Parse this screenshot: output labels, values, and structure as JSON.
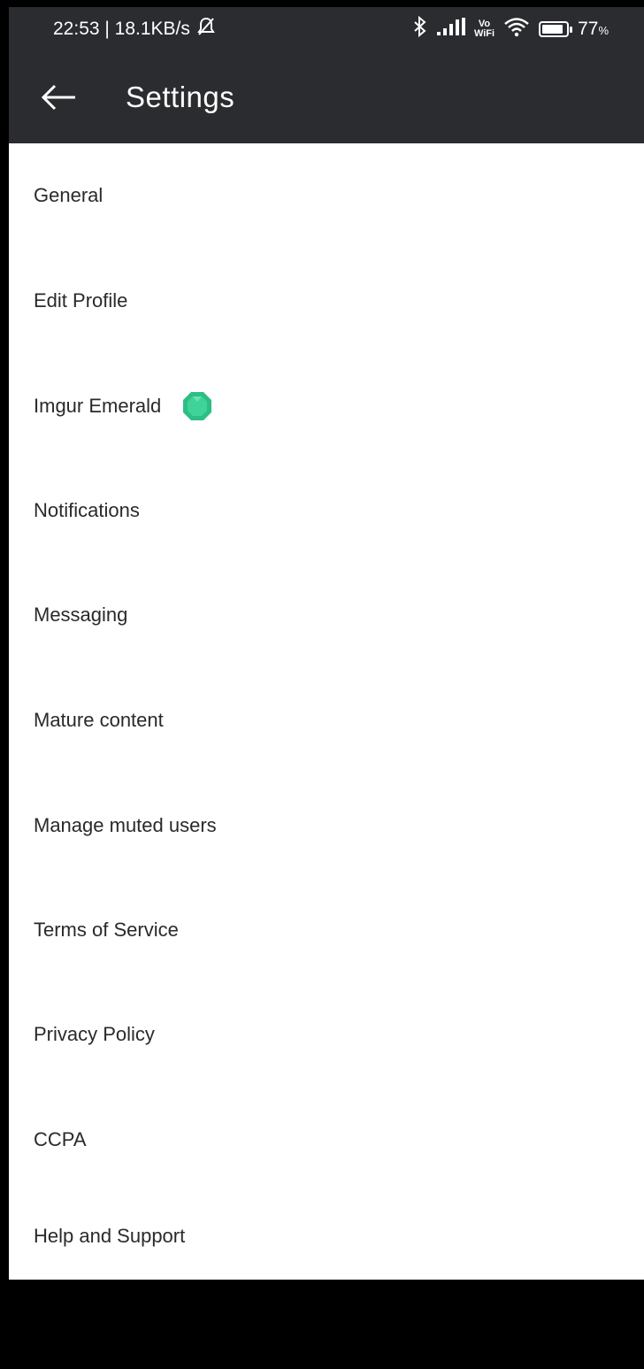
{
  "status_bar": {
    "time_speed": "22:53 | 18.1KB/s",
    "mute_icon": "bell-off-icon",
    "vowifi_top": "Vo",
    "vowifi_bottom": "WiFi",
    "battery_percent": "77",
    "battery_unit": "%"
  },
  "app_bar": {
    "back_icon": "arrow-left-icon",
    "title": "Settings"
  },
  "settings": {
    "items": [
      {
        "label": "General"
      },
      {
        "label": "Edit Profile"
      },
      {
        "label": "Imgur Emerald",
        "badge_icon": "emerald-gem-icon"
      },
      {
        "label": "Notifications"
      },
      {
        "label": "Messaging"
      },
      {
        "label": "Mature content"
      },
      {
        "label": "Manage muted users"
      },
      {
        "label": "Terms of Service"
      },
      {
        "label": "Privacy Policy"
      },
      {
        "label": "CCPA"
      },
      {
        "label": "Help and Support"
      }
    ]
  },
  "colors": {
    "app_bar_bg": "#2b2c30",
    "emerald": "#2ebd85"
  }
}
